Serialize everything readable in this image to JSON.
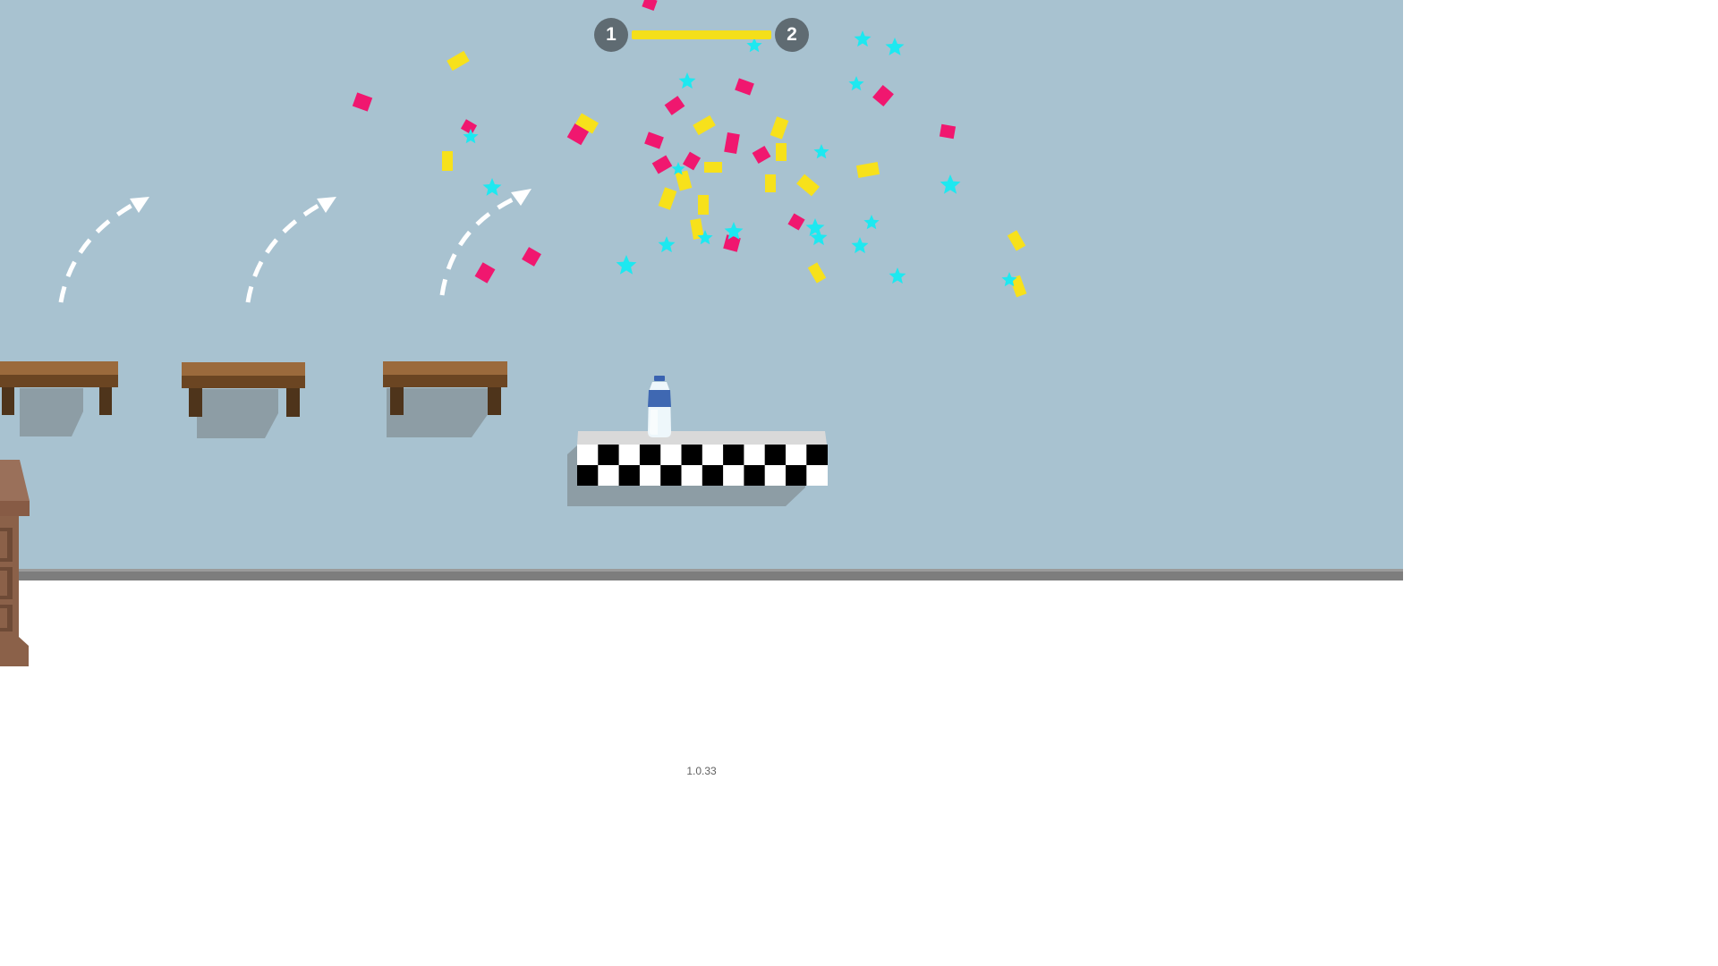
{
  "hud": {
    "current_level": "1",
    "next_level": "2",
    "level_progress": 1.0
  },
  "footer": {
    "version": "1.0.33"
  },
  "colors": {
    "wall": "#a8c2d0",
    "floor": "#ffffff",
    "progress_fill": "#f4df1a",
    "level_node": "#5f6b72",
    "confetti_pink": "#f0176f",
    "confetti_yellow": "#f7e11b",
    "confetti_cyan": "#1ee8f0"
  },
  "icons": {
    "trajectory_hint": "dashed-arc-arrow-icon",
    "bottle": "water-bottle-icon",
    "goal": "checkered-finish-platform"
  }
}
